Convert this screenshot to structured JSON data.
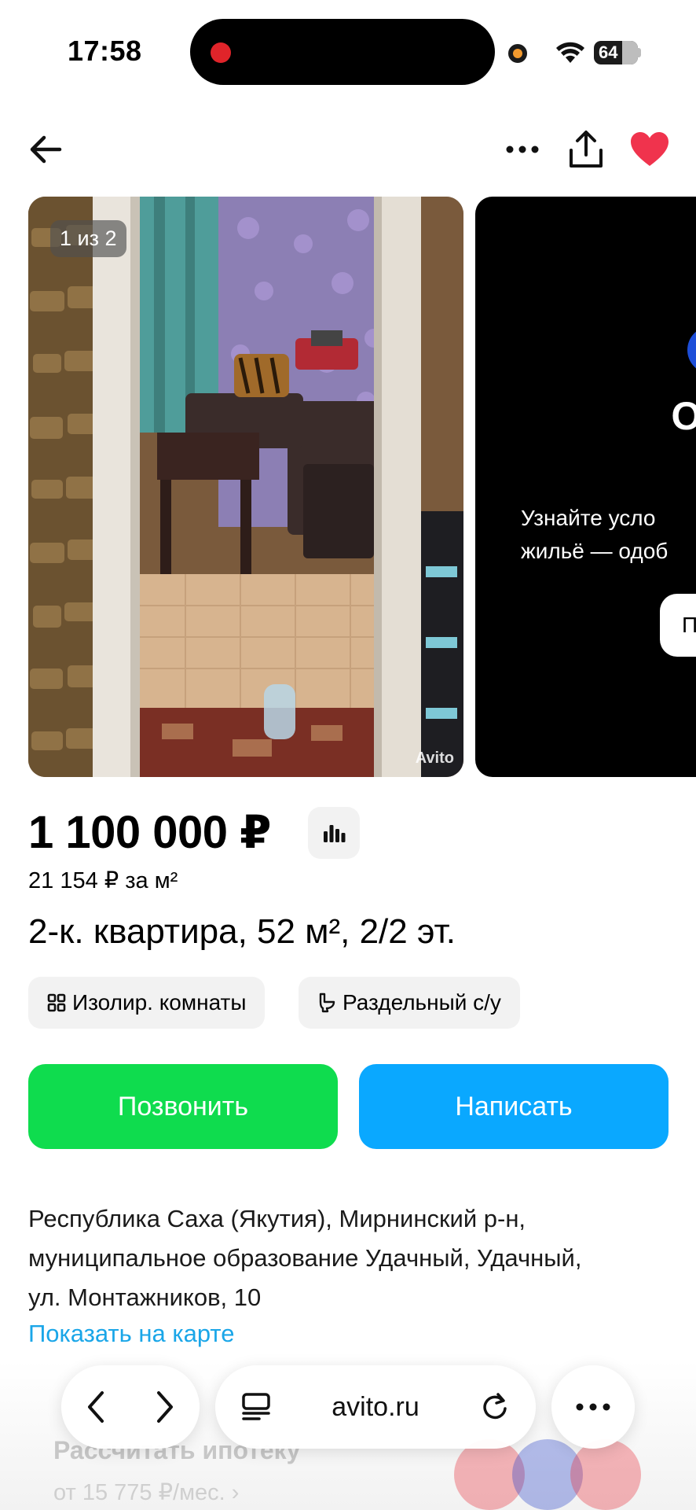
{
  "status_bar": {
    "time": "17:58",
    "battery": "64"
  },
  "header": {
    "back_icon": "arrow-left-icon",
    "more_icon": "more-dots-icon",
    "share_icon": "share-icon",
    "favorite_icon": "heart-icon",
    "favorite_color": "#f0334d"
  },
  "gallery": {
    "counter": "1 из 2",
    "watermark": "Avito",
    "promo": {
      "title_line1": "Одобр",
      "title_line2": "о",
      "subtitle_line1": "Узнайте усло",
      "subtitle_line2": "жильё — одоб",
      "button_label": "П"
    }
  },
  "listing": {
    "price": "1 100 000 ₽",
    "price_per_m2": "21 154 ₽ за м²",
    "title": "2-к. квартира, 52 м², 2/2 эт.",
    "chips": [
      {
        "icon": "rooms-grid-icon",
        "label": "Изолир. комнаты"
      },
      {
        "icon": "toilet-icon",
        "label": "Раздельный с/у"
      }
    ]
  },
  "actions": {
    "call_label": "Позвонить",
    "write_label": "Написать",
    "call_color": "#0fdc4e",
    "write_color": "#0aa8ff"
  },
  "address": {
    "line1": "Республика Саха (Якутия), Мирнинский р-н,",
    "line2": "муниципальное образование Удачный, Удачный,",
    "line3": "ул. Монтажников, 10",
    "map_link": "Показать на карте"
  },
  "mortgage": {
    "title": "Рассчитать ипотеку",
    "subtitle": "от 15 775 ₽/мес. ›"
  },
  "browser": {
    "url": "avito.ru",
    "back_icon": "chevron-left-icon",
    "forward_icon": "chevron-right-icon",
    "tabs_icon": "reader-icon",
    "reload_icon": "reload-icon",
    "menu_icon": "more-dots-icon"
  }
}
